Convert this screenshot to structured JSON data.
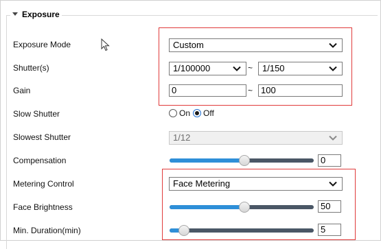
{
  "section": {
    "title": "Exposure"
  },
  "fields": {
    "exposure_mode": {
      "label": "Exposure Mode",
      "value": "Custom"
    },
    "shutter": {
      "label": "Shutter(s)",
      "min_value": "1/100000",
      "separator": "~",
      "max_value": "1/150"
    },
    "gain": {
      "label": "Gain",
      "min_value": "0",
      "separator": "~",
      "max_value": "100"
    },
    "slow_shutter": {
      "label": "Slow Shutter",
      "option_on": "On",
      "option_off": "Off",
      "selected": "Off"
    },
    "slowest_shutter": {
      "label": "Slowest Shutter",
      "value": "1/12",
      "disabled": true
    },
    "compensation": {
      "label": "Compensation",
      "value": "0",
      "slider_fraction": 0.52
    },
    "metering_control": {
      "label": "Metering Control",
      "value": "Face Metering"
    },
    "face_brightness": {
      "label": "Face Brightness",
      "value": "50",
      "slider_fraction": 0.52
    },
    "min_duration": {
      "label": "Min. Duration(min)",
      "value": "5",
      "slider_fraction": 0.1
    }
  },
  "colors": {
    "highlight": "#e03a3a",
    "slider_fill": "#2e8fd8",
    "slider_track": "#4a5766"
  }
}
